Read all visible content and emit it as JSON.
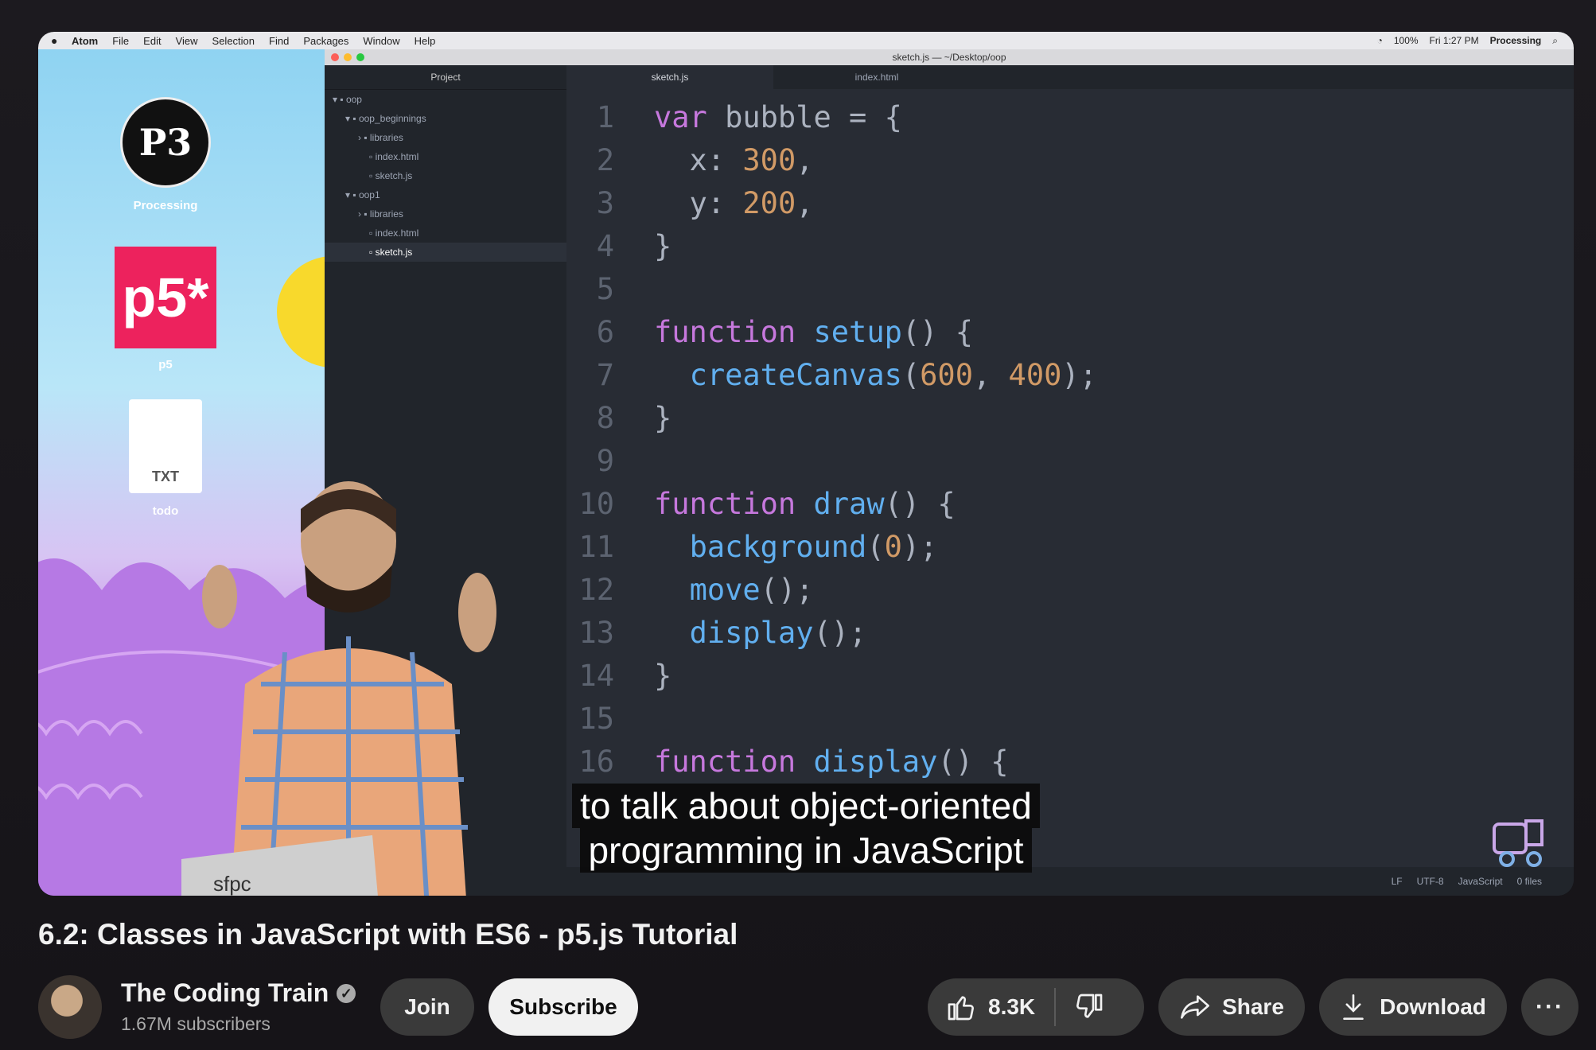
{
  "menubar": {
    "items": [
      "Atom",
      "File",
      "Edit",
      "View",
      "Selection",
      "Find",
      "Packages",
      "Window",
      "Help"
    ],
    "battery": "100%",
    "time": "Fri 1:27 PM",
    "app": "Processing"
  },
  "desktop": {
    "icons": [
      {
        "label": "Processing",
        "glyph": "P3"
      },
      {
        "label": "p5",
        "glyph": "p5*"
      },
      {
        "label": "todo",
        "glyph": "TXT"
      }
    ],
    "laptop_sticker": "sfpc"
  },
  "editor": {
    "window_title": "sketch.js — ~/Desktop/oop",
    "tree_header": "Project",
    "tree": [
      "oop",
      "oop_beginnings",
      "libraries",
      "index.html",
      "sketch.js",
      "oop1",
      "libraries",
      "index.html",
      "sketch.js"
    ],
    "tabs": [
      "sketch.js",
      "index.html"
    ],
    "line_numbers": [
      "1",
      "2",
      "3",
      "4",
      "5",
      "6",
      "7",
      "8",
      "9",
      "10",
      "11",
      "12",
      "13",
      "14",
      "15",
      "16"
    ],
    "status": [
      "LF",
      "UTF-8",
      "JavaScript",
      "0 files"
    ]
  },
  "caption": {
    "line1": "to talk about object-oriented",
    "line2": "programming in JavaScript"
  },
  "video": {
    "title": "6.2: Classes in JavaScript with ES6 - p5.js Tutorial"
  },
  "channel": {
    "name": "The Coding Train",
    "subscribers": "1.67M subscribers",
    "join_label": "Join",
    "subscribe_label": "Subscribe"
  },
  "actions": {
    "like_count": "8.3K",
    "share_label": "Share",
    "download_label": "Download",
    "more_label": "···"
  },
  "colors": {
    "accent_keyword": "#c678dd",
    "accent_function": "#61afef",
    "accent_number": "#d19a66",
    "p5_brand": "#ed225d"
  }
}
